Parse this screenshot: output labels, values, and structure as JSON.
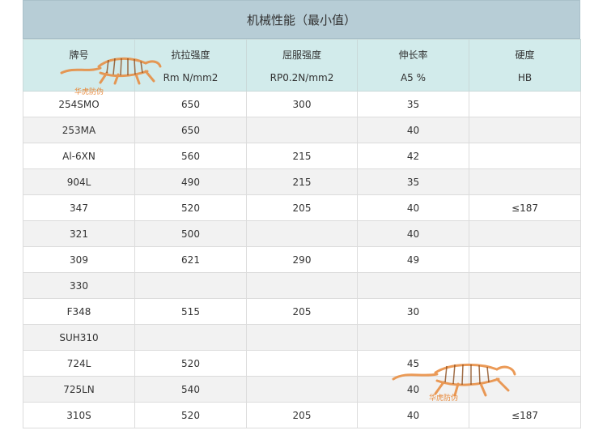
{
  "title": "机械性能（最小值）",
  "headers": [
    {
      "line1": "牌号",
      "line2": ""
    },
    {
      "line1": "抗拉强度",
      "line2": "Rm N/mm2"
    },
    {
      "line1": "屈服强度",
      "line2": "RP0.2N/mm2"
    },
    {
      "line1": "伸长率",
      "line2": "A5 %"
    },
    {
      "line1": "硬度",
      "line2": "HB"
    }
  ],
  "rows": [
    [
      "254SMO",
      "650",
      "300",
      "35",
      ""
    ],
    [
      "253MA",
      "650",
      "",
      "40",
      ""
    ],
    [
      "Al-6XN",
      "560",
      "215",
      "42",
      ""
    ],
    [
      "904L",
      "490",
      "215",
      "35",
      ""
    ],
    [
      "347",
      "520",
      "205",
      "40",
      "≤187"
    ],
    [
      "321",
      "500",
      "",
      "40",
      ""
    ],
    [
      "309",
      "621",
      "290",
      "49",
      ""
    ],
    [
      "330",
      "",
      "",
      "",
      ""
    ],
    [
      "F348",
      "515",
      "205",
      "30",
      ""
    ],
    [
      "SUH310",
      "",
      "",
      "",
      ""
    ],
    [
      "724L",
      "520",
      "",
      "45",
      ""
    ],
    [
      "725LN",
      "540",
      "",
      "40",
      ""
    ],
    [
      "310S",
      "520",
      "205",
      "40",
      "≤187"
    ]
  ],
  "watermark": {
    "text": "华虎防伪",
    "icon": "tiger-icon",
    "color": "#e8893a"
  },
  "colors": {
    "title_bg": "#b7cdd6",
    "header_bg": "#d2ebeb",
    "row_alt_bg": "#f2f2f2"
  }
}
